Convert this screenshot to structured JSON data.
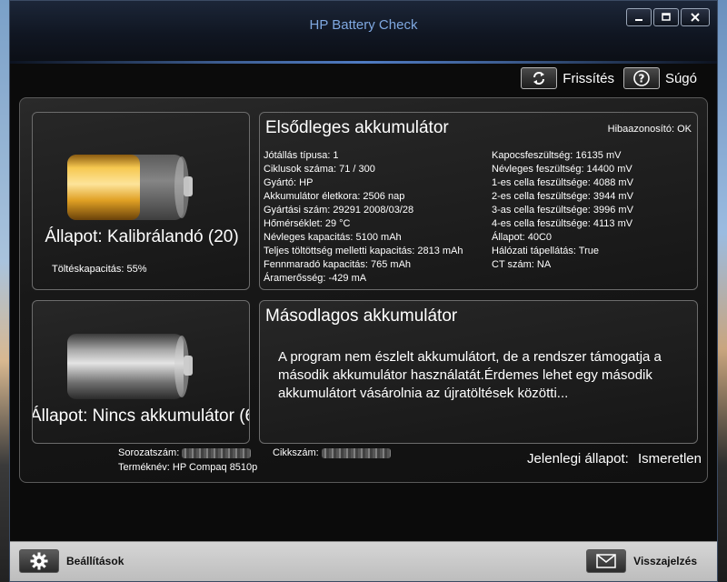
{
  "window": {
    "title": "HP Battery Check"
  },
  "toolbar": {
    "refresh_label": "Frissítés",
    "help_label": "Súgó",
    "refresh_icon": "refresh-arrows-icon",
    "help_icon": "question-icon"
  },
  "primary": {
    "status": "Állapot: Kalibrálandó (20)",
    "charge_label": "Töltéskapacitás:",
    "charge_value": "55%",
    "charge_fraction": 0.55,
    "title": "Elsődleges akkumulátor",
    "error_id": "Hibaazonosító: OK",
    "left_lines": [
      "Jótállás típusa: 1",
      "Ciklusok száma: 71 / 300",
      "Gyártó: HP",
      "Akkumulátor életkora: 2506 nap",
      "Gyártási szám: 29291 2008/03/28",
      "Hőmérséklet: 29 °C",
      "Névleges kapacitás: 5100 mAh",
      "Teljes töltöttség melletti kapacitás: 2813 mAh",
      "Fennmaradó kapacitás: 765 mAh",
      "Áramerősség: -429 mA"
    ],
    "right_lines": [
      "Kapocsfeszültség: 16135 mV",
      "Névleges feszültség: 14400 mV",
      "1-es cella feszültsége: 4088 mV",
      "2-es cella feszültsége: 3944 mV",
      "3-as cella feszültsége: 3996 mV",
      "4-es cella feszültsége: 4113 mV",
      "Állapot: 40C0",
      "Hálózati tápellátás: True",
      "CT szám: NA"
    ],
    "battery_color": "#e8a822"
  },
  "secondary": {
    "status": "Állapot: Nincs akkumulátor (6",
    "title": "Másodlagos akkumulátor",
    "message": "A program nem észlelt akkumulátort, de a rendszer támogatja a második akkumulátor használatát.Érdemes lehet egy második akkumulátort vásárolnia az újratöltések közötti...",
    "battery_color": "#8a8a8a"
  },
  "footer": {
    "serial_label": "Sorozatszám:",
    "product_label": "Terméknév:",
    "product_value": "HP Compaq 8510p",
    "part_label": "Cikkszám:",
    "current_state_label": "Jelenlegi állapot:",
    "current_state_value": "Ismeretlen"
  },
  "bottom": {
    "settings_label": "Beállítások",
    "feedback_label": "Visszajelzés",
    "settings_icon": "gear-icon",
    "feedback_icon": "envelope-icon"
  }
}
